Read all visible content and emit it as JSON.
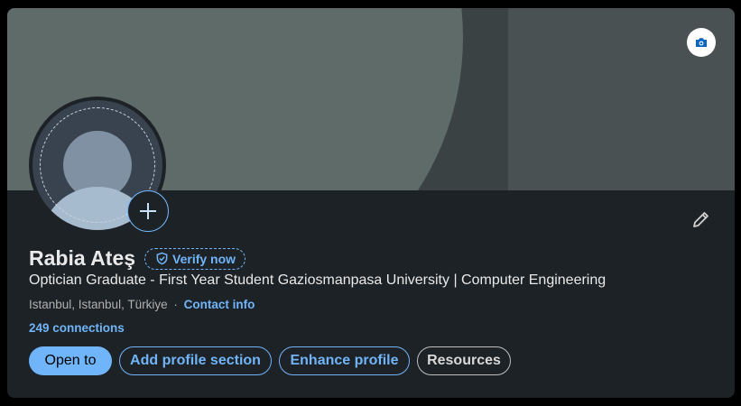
{
  "profile": {
    "name": "Rabia Ateş",
    "verify_label": "Verify now",
    "headline": "Optician Graduate - First Year Student Gaziosmanpasa University | Computer Engineering",
    "location": "Istanbul, Istanbul, Türkiye",
    "location_separator": "·",
    "contact_info_label": "Contact info",
    "connections_label": "249 connections"
  },
  "actions": {
    "open_to": "Open to",
    "add_profile_section": "Add profile section",
    "enhance_profile": "Enhance profile",
    "resources": "Resources"
  },
  "icons": {
    "banner_edit": "camera-icon",
    "avatar_add": "plus-icon",
    "intro_edit": "pencil-icon",
    "verify": "shield-check-icon"
  },
  "colors": {
    "card_background": "#1d2226",
    "accent_blue": "#70b5f9",
    "primary_text": "#e9e9e9",
    "secondary_text": "#b0b0b0",
    "banner_dark": "#3b4244",
    "banner_light": "#5f6b68"
  }
}
